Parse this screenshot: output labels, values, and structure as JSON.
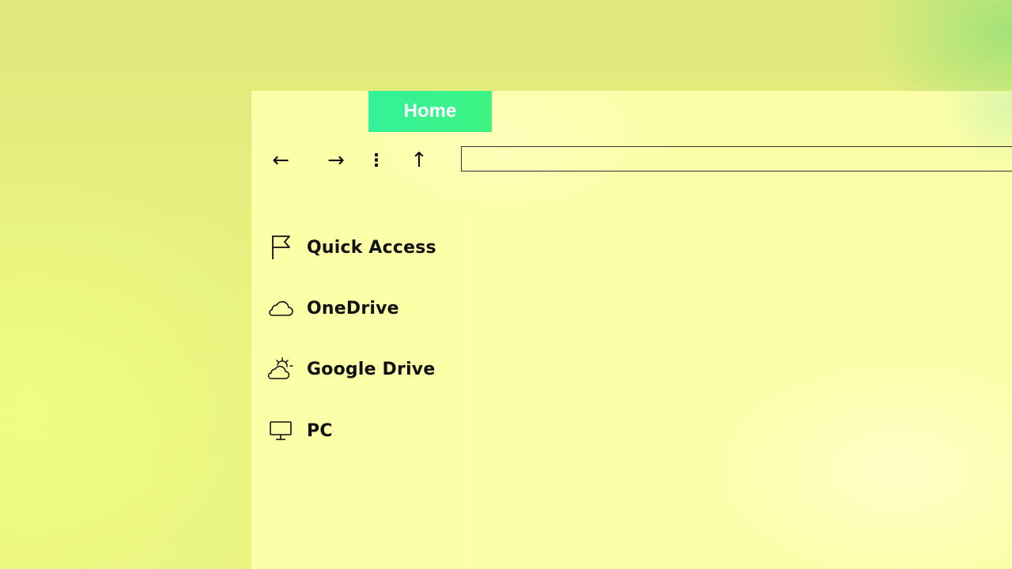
{
  "tabs": [
    {
      "label": "Home",
      "color": "#38f28e"
    }
  ],
  "toolbar": {
    "back_glyph": "←",
    "forward_glyph": "→",
    "more_glyph": "⋮",
    "up_glyph": "↑",
    "back_icon": "arrow-left-icon",
    "forward_icon": "arrow-right-icon",
    "more_icon": "vertical-ellipsis-icon",
    "up_icon": "arrow-up-icon"
  },
  "address_bar": {
    "value": "",
    "placeholder": ""
  },
  "sidebar": {
    "items": [
      {
        "label": "Quick Access",
        "icon": "flag-icon"
      },
      {
        "label": "OneDrive",
        "icon": "cloud-icon"
      },
      {
        "label": "Google Drive",
        "icon": "sun-cloud-icon"
      },
      {
        "label": "PC",
        "icon": "monitor-icon"
      }
    ]
  },
  "colors": {
    "tab_accent": "#38f28e",
    "window_bg": "#fdfea8",
    "text": "#111111"
  }
}
